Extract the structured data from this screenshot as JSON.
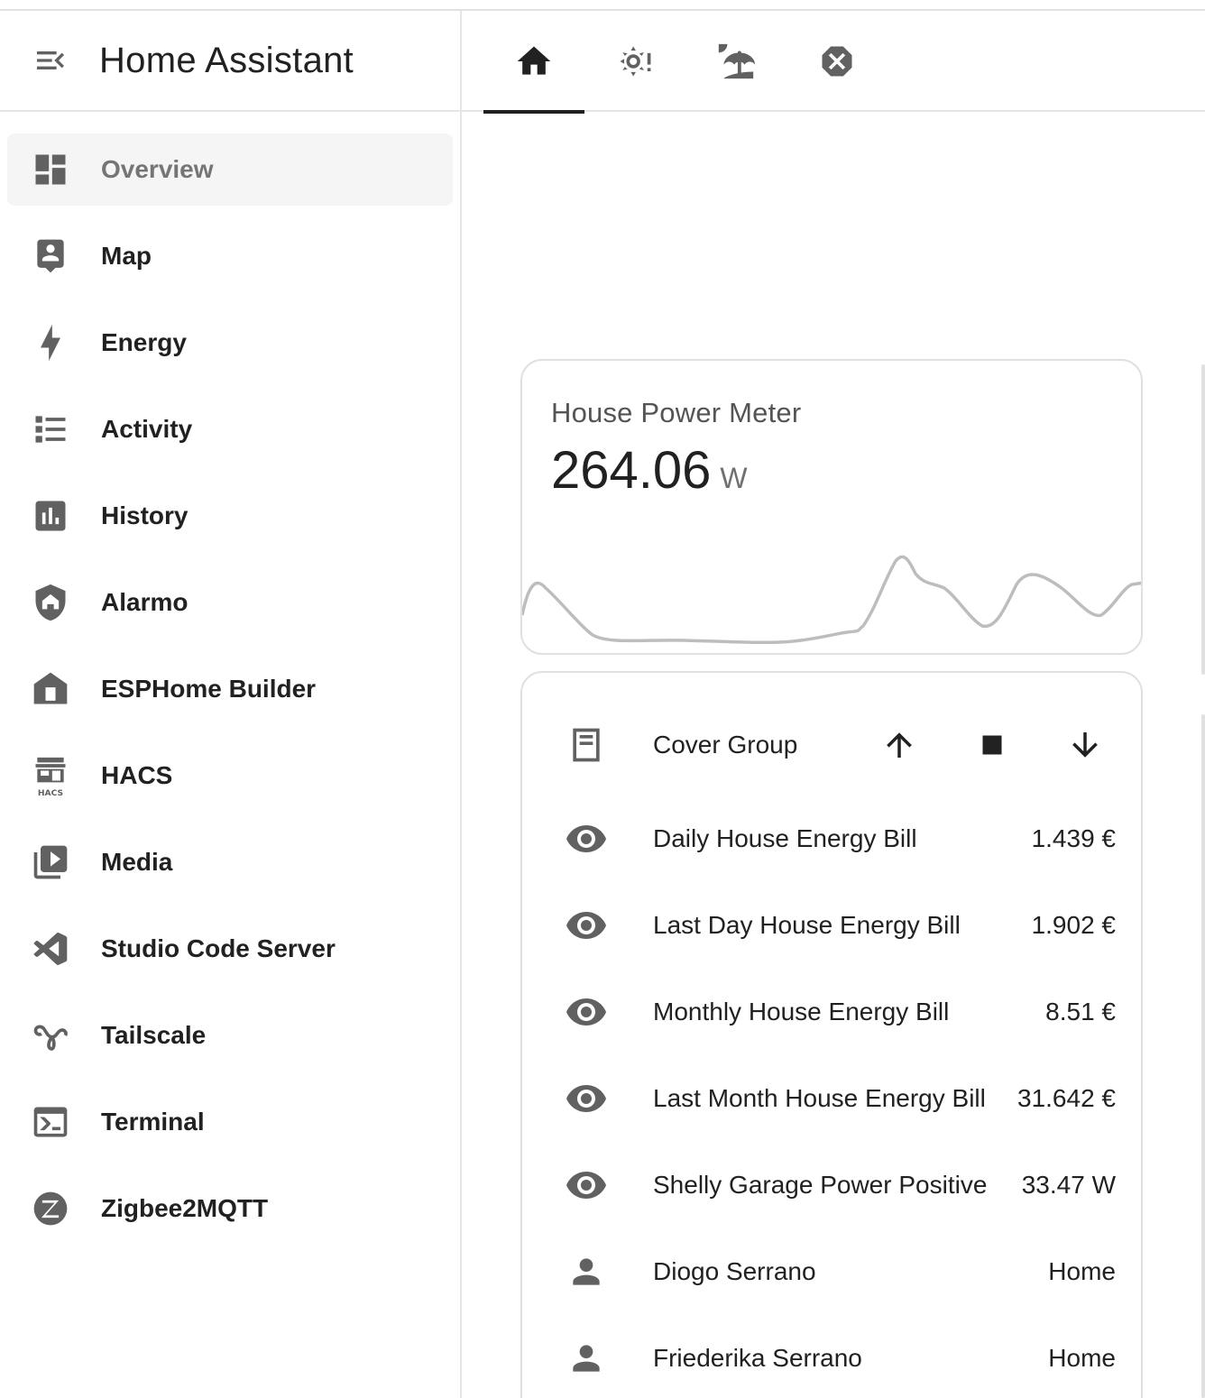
{
  "app": {
    "title": "Home Assistant"
  },
  "sidebar": {
    "items": [
      {
        "label": "Overview",
        "icon": "view-dashboard-icon",
        "active": true
      },
      {
        "label": "Map",
        "icon": "map-person-icon"
      },
      {
        "label": "Energy",
        "icon": "lightning-bolt-icon"
      },
      {
        "label": "Activity",
        "icon": "format-list-bulleted-icon"
      },
      {
        "label": "History",
        "icon": "chart-box-icon"
      },
      {
        "label": "Alarmo",
        "icon": "shield-home-icon"
      },
      {
        "label": "ESPHome Builder",
        "icon": "esphome-icon"
      },
      {
        "label": "HACS",
        "icon": "hacs-icon"
      },
      {
        "label": "Media",
        "icon": "play-box-multiple-icon"
      },
      {
        "label": "Studio Code Server",
        "icon": "vscode-icon"
      },
      {
        "label": "Tailscale",
        "icon": "tailscale-icon"
      },
      {
        "label": "Terminal",
        "icon": "console-icon"
      },
      {
        "label": "Zigbee2MQTT",
        "icon": "zigbee-icon"
      }
    ]
  },
  "tabs": [
    {
      "icon": "home-icon",
      "active": true
    },
    {
      "icon": "weather-alert-icon"
    },
    {
      "icon": "beach-icon"
    },
    {
      "icon": "close-octagon-icon"
    }
  ],
  "sensor_card": {
    "name": "House Power Meter",
    "value": "264.06",
    "unit": "W"
  },
  "entities_card": {
    "cover": {
      "name": "Cover Group",
      "icon": "window-shutter-icon"
    },
    "rows": [
      {
        "name": "Daily House Energy Bill",
        "state": "1.439 €",
        "icon": "eye-icon"
      },
      {
        "name": "Last Day House Energy Bill",
        "state": "1.902 €",
        "icon": "eye-icon"
      },
      {
        "name": "Monthly House Energy Bill",
        "state": "8.51 €",
        "icon": "eye-icon"
      },
      {
        "name": "Last Month House Energy Bill",
        "state": "31.642 €",
        "icon": "eye-icon"
      },
      {
        "name": "Shelly Garage Power Positive",
        "state": "33.47 W",
        "icon": "eye-icon"
      },
      {
        "name": "Diogo Serrano",
        "state": "Home",
        "icon": "account-icon"
      },
      {
        "name": "Friederika Serrano",
        "state": "Home",
        "icon": "account-icon"
      }
    ]
  },
  "colors": {
    "icon": "#616161",
    "text": "#212121",
    "active_bg": "#f5f5f5",
    "graph_line": "#bdbdbd"
  }
}
